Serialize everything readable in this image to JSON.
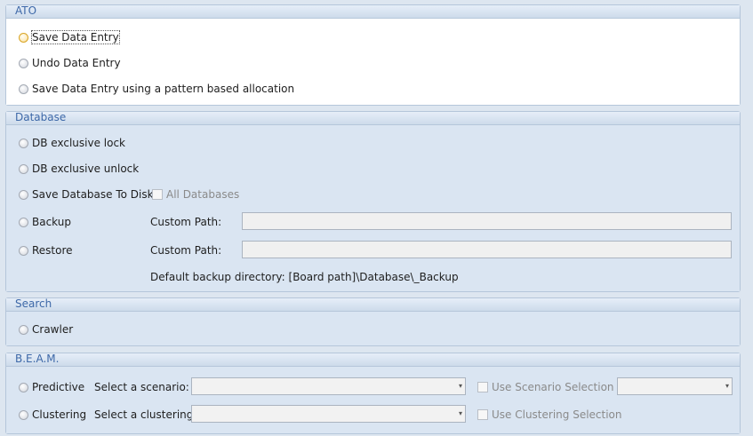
{
  "ato": {
    "title": "ATO",
    "options": [
      "Save Data Entry",
      "Undo Data Entry",
      "Save Data Entry using a pattern based allocation"
    ]
  },
  "database": {
    "title": "Database",
    "options": [
      "DB exclusive lock",
      "DB exclusive unlock",
      "Save Database To Disk",
      "Backup",
      "Restore"
    ],
    "all_databases_label": "All Databases",
    "custom_path_label": "Custom Path:",
    "backup_path_value": "",
    "restore_path_value": "",
    "default_dir_text": "Default backup directory: [Board path]\\Database\\_Backup"
  },
  "search": {
    "title": "Search",
    "options": [
      "Crawler"
    ]
  },
  "beam": {
    "title": "B.E.A.M.",
    "predictive_label": "Predictive",
    "clustering_label": "Clustering",
    "select_scenario_label": "Select a scenario:",
    "select_clustering_label": "Select a clustering:",
    "scenario_value": "",
    "clustering_value": "",
    "use_scenario_label": "Use Scenario Selection",
    "use_clustering_label": "Use Clustering Selection",
    "scenario_selection_value": ""
  },
  "icons": {
    "dropdown": "▾"
  },
  "colors": {
    "group_title": "#3d68a8",
    "background": "#dde6f0",
    "focus_radio": "#f0cf7a"
  }
}
